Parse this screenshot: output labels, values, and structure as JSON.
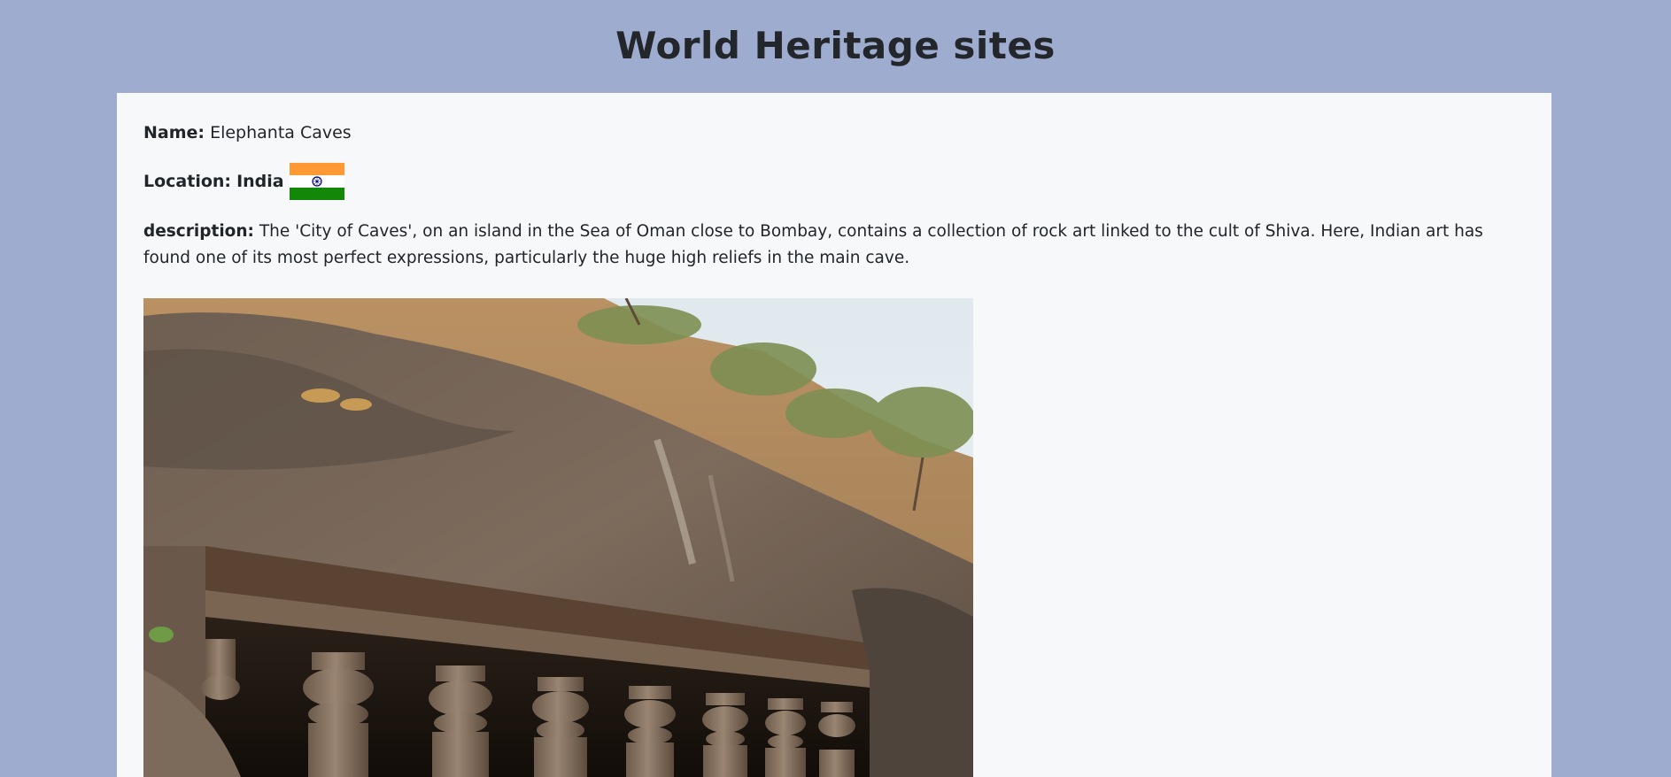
{
  "page": {
    "title": "World Heritage sites"
  },
  "site": {
    "name_label": "Name:",
    "name_value": "Elephanta Caves",
    "location_label": "Location:",
    "location_value": "India",
    "flag_icon": "india-flag-icon",
    "description_label": "description:",
    "description_value": "The 'City of Caves', on an island in the Sea of Oman close to Bombay, contains a collection of rock art linked to the cult of Shiva. Here, Indian art has found one of its most perfect expressions, particularly the huge high reliefs in the main cave."
  },
  "colors": {
    "page_background": "#9eadcf",
    "card_background": "#f7f8fa",
    "flag_saffron": "#ff9933",
    "flag_white": "#ffffff",
    "flag_green": "#138808",
    "flag_chakra": "#000080"
  }
}
